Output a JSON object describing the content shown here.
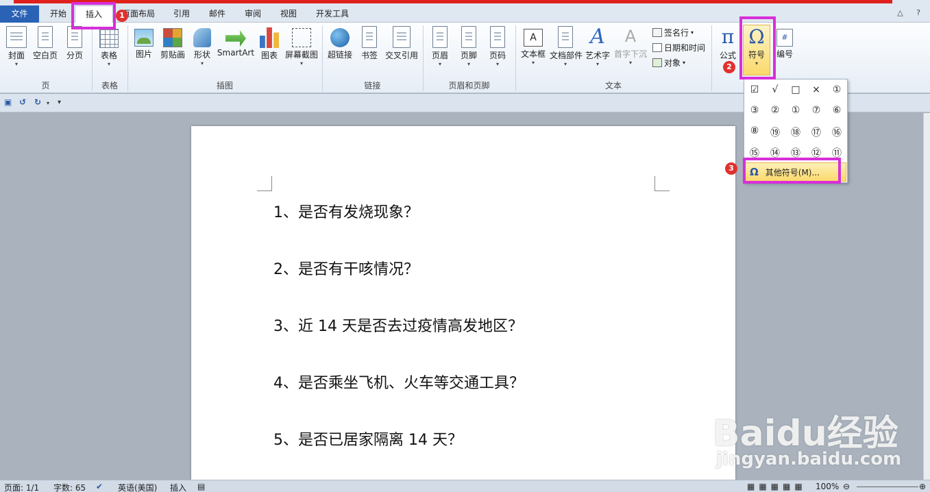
{
  "tabs": [
    "文件",
    "开始",
    "插入",
    "页面布局",
    "引用",
    "邮件",
    "审阅",
    "视图",
    "开发工具"
  ],
  "help_glyphs": "△ ?",
  "ribbon": {
    "pages": {
      "cover": "封面",
      "blank": "空白页",
      "break": "分页",
      "group": "页"
    },
    "table": {
      "label": "表格",
      "group": "表格"
    },
    "illustrations": {
      "picture": "图片",
      "clipart": "剪贴画",
      "shapes": "形状",
      "smartart": "SmartArt",
      "chart": "图表",
      "screenshot": "屏幕截图",
      "group": "插图"
    },
    "links": {
      "hyperlink": "超链接",
      "bookmark": "书签",
      "crossref": "交叉引用",
      "group": "链接"
    },
    "header_footer": {
      "header": "页眉",
      "footer": "页脚",
      "pagenum": "页码",
      "group": "页眉和页脚"
    },
    "text": {
      "textbox": "文本框",
      "quickparts": "文档部件",
      "wordart": "艺术字",
      "dropcap": "首字下沉",
      "signature": "签名行",
      "datetime": "日期和时间",
      "object": "对象",
      "group": "文本"
    },
    "symbols": {
      "equation": "公式",
      "symbol": "符号",
      "numbering": "编号",
      "equation_glyph": "π",
      "symbol_glyph": "Ω"
    }
  },
  "symbol_dropdown": {
    "symbols": [
      "☑",
      "√",
      "□",
      "×",
      "①",
      "③",
      "②",
      "①",
      "⑦",
      "⑥",
      "⑧",
      "⑲",
      "⑱",
      "⑰",
      "⑯",
      "⑮",
      "⑭",
      "⑬",
      "⑫",
      "⑪"
    ],
    "more_label": "其他符号(M)...",
    "more_glyph": "Ω"
  },
  "document": {
    "lines": [
      "1、是否有发烧现象？",
      "2、是否有干咳情况？",
      "3、近 14 天是否去过疫情高发地区？",
      "4、是否乘坐飞机、火车等交通工具？",
      "5、是否已居家隔离 14 天？"
    ]
  },
  "markers": [
    "1",
    "2",
    "3"
  ],
  "status": {
    "page": "页面: 1/1",
    "words": "字数: 65",
    "language": "英语(美国)",
    "mode": "插入",
    "zoom": "100%"
  },
  "watermark": {
    "brand": "Baidu经验",
    "url": "jingyan.baidu.com"
  },
  "colors": {
    "highlight": "#d72fd8",
    "marker": "#e0312e",
    "file_tab": "#2a62b6"
  }
}
